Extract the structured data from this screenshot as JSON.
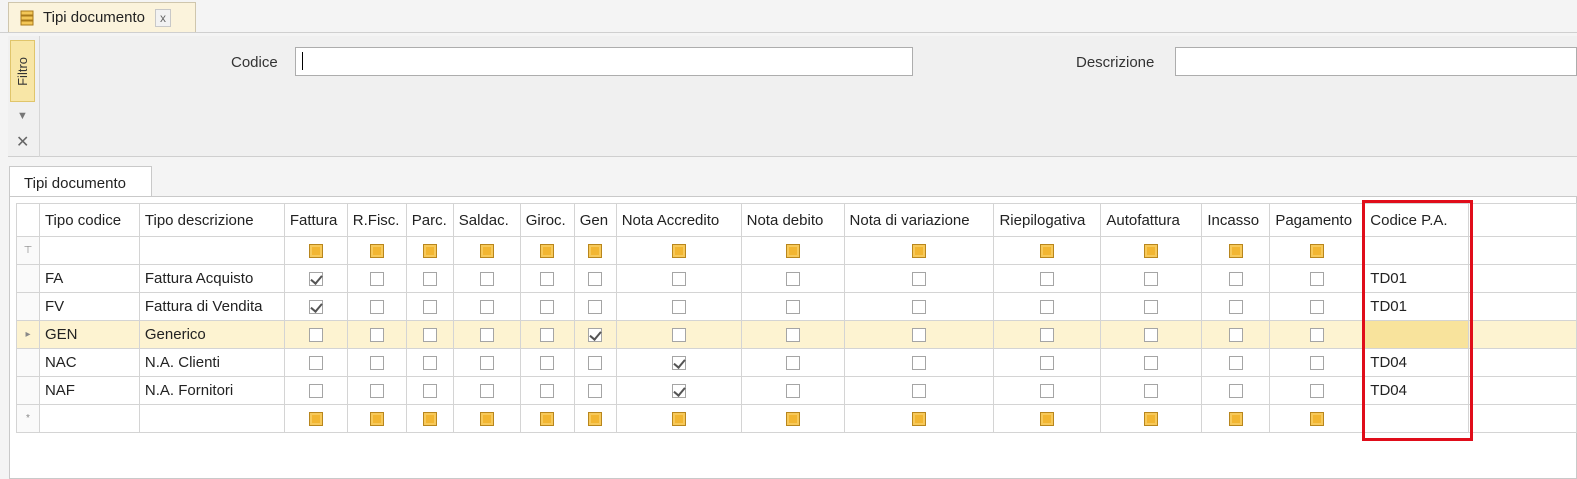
{
  "tab": {
    "title": "Tipi documento",
    "close": "x",
    "icon": "document-stack-icon"
  },
  "filter": {
    "side_label": "Filtro",
    "codice_label": "Codice",
    "codice_value": "",
    "descrizione_label": "Descrizione",
    "descrizione_value": ""
  },
  "grid_tab": "Tipi documento",
  "columns": [
    "Tipo codice",
    "Tipo descrizione",
    "Fattura",
    "R.Fisc.",
    "Parc.",
    "Saldac.",
    "Giroc.",
    "Gen",
    "Nota Accredito",
    "Nota debito",
    "Nota di variazione",
    "Riepilogativa",
    "Autofattura",
    "Incasso",
    "Pagamento",
    "Codice P.A."
  ],
  "rows": [
    {
      "codice": "FA",
      "descrizione": "Fattura Acquisto",
      "flags": [
        true,
        false,
        false,
        false,
        false,
        false,
        false,
        false,
        false,
        false,
        false,
        false,
        false
      ],
      "codice_pa": "TD01"
    },
    {
      "codice": "FV",
      "descrizione": "Fattura di Vendita",
      "flags": [
        true,
        false,
        false,
        false,
        false,
        false,
        false,
        false,
        false,
        false,
        false,
        false,
        false
      ],
      "codice_pa": "TD01"
    },
    {
      "codice": "GEN",
      "descrizione": "Generico",
      "flags": [
        false,
        false,
        false,
        false,
        false,
        true,
        false,
        false,
        false,
        false,
        false,
        false,
        false
      ],
      "codice_pa": ""
    },
    {
      "codice": "NAC",
      "descrizione": "N.A. Clienti",
      "flags": [
        false,
        false,
        false,
        false,
        false,
        false,
        true,
        false,
        false,
        false,
        false,
        false,
        false
      ],
      "codice_pa": "TD04"
    },
    {
      "codice": "NAF",
      "descrizione": "N.A. Fornitori",
      "flags": [
        false,
        false,
        false,
        false,
        false,
        false,
        true,
        false,
        false,
        false,
        false,
        false,
        false
      ],
      "codice_pa": "TD04"
    }
  ],
  "selected_row": 2,
  "highlight_color": "#e00d1a",
  "selection_color": "#fdf3d1"
}
